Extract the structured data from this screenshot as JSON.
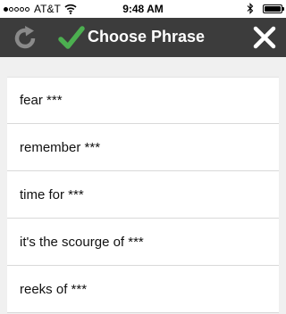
{
  "status_bar": {
    "carrier": "AT&T",
    "time": "9:48 AM",
    "signal_bars_filled": 1,
    "signal_bars_total": 5,
    "battery_level": 1.0
  },
  "nav": {
    "title": "Choose Phrase",
    "icons": {
      "refresh": "refresh-icon",
      "check": "check-icon",
      "close": "close-icon"
    },
    "colors": {
      "background": "#3c3c3c",
      "check": "#4caf50"
    }
  },
  "phrases": [
    "fear ***",
    "remember ***",
    "time for ***",
    "it's the scourge of ***",
    "reeks of ***"
  ]
}
